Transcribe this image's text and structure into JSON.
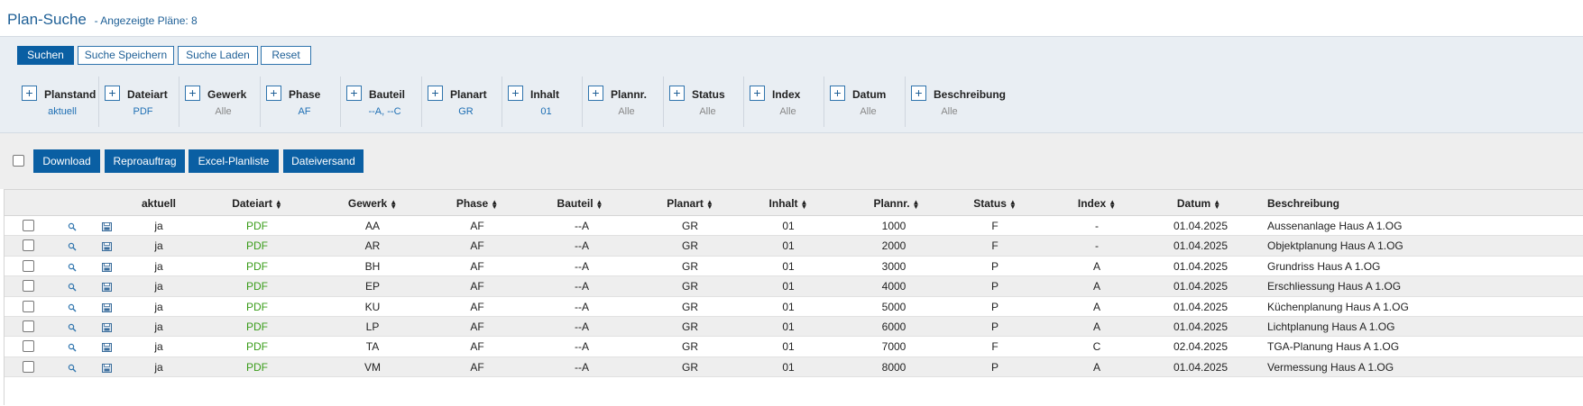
{
  "header": {
    "title": "Plan-Suche",
    "subtitle": "- Angezeigte Pläne: 8"
  },
  "search_buttons": {
    "search": "Suchen",
    "save": "Suche Speichern",
    "load": "Suche Laden",
    "reset": "Reset"
  },
  "filters": [
    {
      "label": "Planstand",
      "value": "aktuell",
      "set": true
    },
    {
      "label": "Dateiart",
      "value": "PDF",
      "set": true
    },
    {
      "label": "Gewerk",
      "value": "Alle",
      "set": false
    },
    {
      "label": "Phase",
      "value": "AF",
      "set": true
    },
    {
      "label": "Bauteil",
      "value": "--A, --C",
      "set": true
    },
    {
      "label": "Planart",
      "value": "GR",
      "set": true
    },
    {
      "label": "Inhalt",
      "value": "01",
      "set": true
    },
    {
      "label": "Plannr.",
      "value": "Alle",
      "set": false
    },
    {
      "label": "Status",
      "value": "Alle",
      "set": false
    },
    {
      "label": "Index",
      "value": "Alle",
      "set": false
    },
    {
      "label": "Datum",
      "value": "Alle",
      "set": false
    },
    {
      "label": "Beschreibung",
      "value": "Alle",
      "set": false
    }
  ],
  "filter_plus_symbol": "+",
  "actions": {
    "download": "Download",
    "repro": "Reproauftrag",
    "excel": "Excel-Planliste",
    "dateiversand": "Dateiversand"
  },
  "table": {
    "headers": [
      "aktuell",
      "Dateiart",
      "Gewerk",
      "Phase",
      "Bauteil",
      "Planart",
      "Inhalt",
      "Plannr.",
      "Status",
      "Index",
      "Datum",
      "Beschreibung"
    ],
    "rows": [
      [
        "ja",
        "PDF",
        "AA",
        "AF",
        "--A",
        "GR",
        "01",
        "1000",
        "F",
        "-",
        "01.04.2025",
        "Aussenanlage Haus A 1.OG"
      ],
      [
        "ja",
        "PDF",
        "AR",
        "AF",
        "--A",
        "GR",
        "01",
        "2000",
        "F",
        "-",
        "01.04.2025",
        "Objektplanung Haus A 1.OG"
      ],
      [
        "ja",
        "PDF",
        "BH",
        "AF",
        "--A",
        "GR",
        "01",
        "3000",
        "P",
        "A",
        "01.04.2025",
        "Grundriss Haus A 1.OG"
      ],
      [
        "ja",
        "PDF",
        "EP",
        "AF",
        "--A",
        "GR",
        "01",
        "4000",
        "P",
        "A",
        "01.04.2025",
        "Erschliessung Haus A 1.OG"
      ],
      [
        "ja",
        "PDF",
        "KU",
        "AF",
        "--A",
        "GR",
        "01",
        "5000",
        "P",
        "A",
        "01.04.2025",
        "Küchenplanung Haus A 1.OG"
      ],
      [
        "ja",
        "PDF",
        "LP",
        "AF",
        "--A",
        "GR",
        "01",
        "6000",
        "P",
        "A",
        "01.04.2025",
        "Lichtplanung Haus A 1.OG"
      ],
      [
        "ja",
        "PDF",
        "TA",
        "AF",
        "--A",
        "GR",
        "01",
        "7000",
        "F",
        "C",
        "02.04.2025",
        "TGA-Planung Haus A 1.OG"
      ],
      [
        "ja",
        "PDF",
        "VM",
        "AF",
        "--A",
        "GR",
        "01",
        "8000",
        "P",
        "A",
        "01.04.2025",
        "Vermessung Haus A 1.OG"
      ]
    ]
  },
  "colors": {
    "accent": "#0a5fa3",
    "title": "#1e5f96",
    "pdf": "#3a9c1a",
    "panel": "#e9eef3"
  },
  "icons": {
    "row_preview": "magnifier-icon",
    "row_save": "floppy-disk-icon",
    "sort": "sort-arrows-icon"
  }
}
